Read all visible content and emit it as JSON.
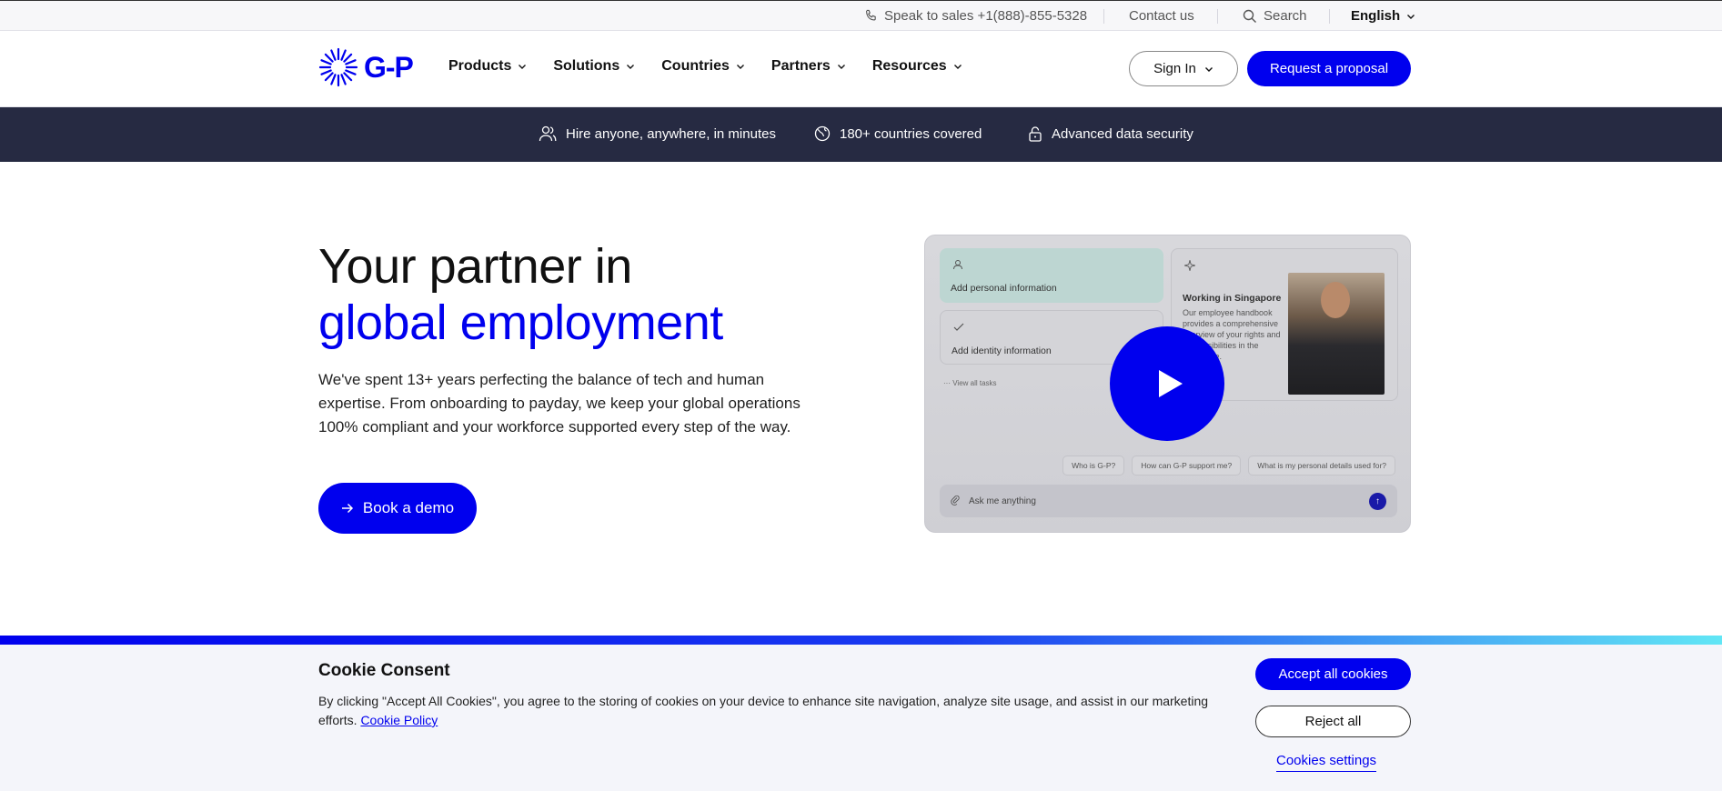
{
  "utility_bar": {
    "sales_label": "Speak to sales +1(888)-855-5328",
    "contact_label": "Contact us",
    "search_label": "Search",
    "language": "English"
  },
  "header": {
    "logo_text": "G-P",
    "nav": [
      {
        "label": "Products"
      },
      {
        "label": "Solutions"
      },
      {
        "label": "Countries"
      },
      {
        "label": "Partners"
      },
      {
        "label": "Resources"
      }
    ],
    "signin_label": "Sign In",
    "proposal_label": "Request a proposal"
  },
  "features": [
    {
      "label": "Hire anyone, anywhere, in minutes",
      "icon": "people-icon"
    },
    {
      "label": "180+ countries covered",
      "icon": "globe-icon"
    },
    {
      "label": "Advanced data security",
      "icon": "lock-icon"
    }
  ],
  "hero": {
    "title_line1": "Your partner in",
    "title_line2": "global employment",
    "description": "We've spent 13+ years perfecting the balance of tech and human expertise. From onboarding to payday, we keep your global operations 100% compliant and your workforce supported every step of the way.",
    "cta_label": "Book a demo"
  },
  "video": {
    "card1_title": "Add personal information",
    "card2_title": "Add identity information",
    "card3_title": "Working in Singapore",
    "card3_desc": "Our employee handbook provides a comprehensive overview of your rights and responsibilities in the workplace.",
    "view_all": "View all tasks",
    "chips": [
      "Who is G-P?",
      "How can G-P support me?",
      "What is my personal details used for?"
    ],
    "ask_placeholder": "Ask me anything"
  },
  "cookie": {
    "title": "Cookie Consent",
    "text": "By clicking \"Accept All Cookies\", you agree to the storing of cookies on your device to enhance site navigation, analyze site usage, and assist in our marketing efforts.",
    "policy_link": "Cookie Policy",
    "accept_label": "Accept all cookies",
    "reject_label": "Reject all",
    "settings_label": "Cookies settings"
  },
  "colors": {
    "brand_blue": "#0000ee",
    "strip_bg": "#262a42",
    "cookie_bg": "#f4f5fa"
  }
}
